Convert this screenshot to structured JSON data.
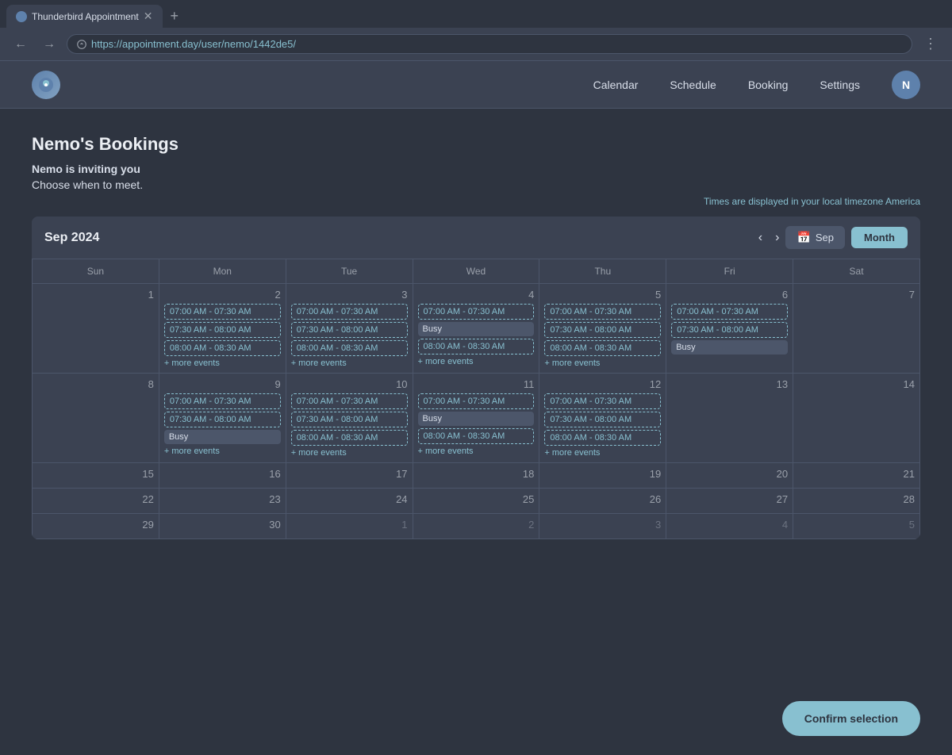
{
  "browser": {
    "tab_label": "Thunderbird Appointment",
    "url": "https://appointment.day/user/nemo/1442de5/",
    "new_tab_label": "+"
  },
  "nav": {
    "calendar": "Calendar",
    "schedule": "Schedule",
    "booking": "Booking",
    "settings": "Settings",
    "avatar_initial": "N"
  },
  "page": {
    "title": "Nemo's Bookings",
    "invite_text": "Nemo is inviting you",
    "choose_text": "Choose when to meet.",
    "timezone_text": "Times are displayed in your local timezone America"
  },
  "calendar": {
    "header_title": "Sep 2024",
    "sep_button": "Sep",
    "month_button": "Month",
    "prev_label": "‹",
    "next_label": "›",
    "days": [
      "Sun",
      "Mon",
      "Tue",
      "Wed",
      "Thu",
      "Fri",
      "Sat"
    ],
    "weeks": [
      [
        {
          "num": "1",
          "events": [],
          "other": false
        },
        {
          "num": "2",
          "events": [
            "07:00 AM - 07:30 AM",
            "07:30 AM - 08:00 AM",
            "08:00 AM - 08:30 AM"
          ],
          "more": "+ more events",
          "other": false
        },
        {
          "num": "3",
          "events": [
            "07:00 AM - 07:30 AM",
            "07:30 AM - 08:00 AM",
            "08:00 AM - 08:30 AM"
          ],
          "more": "+ more events",
          "other": false
        },
        {
          "num": "4",
          "events": [
            "07:00 AM - 07:30 AM",
            "busy",
            "08:00 AM - 08:30 AM"
          ],
          "more": "+ more events",
          "other": false
        },
        {
          "num": "5",
          "events": [
            "07:00 AM - 07:30 AM",
            "07:30 AM - 08:00 AM",
            "08:00 AM - 08:30 AM"
          ],
          "more": "+ more events",
          "other": false
        },
        {
          "num": "6",
          "events": [
            "07:00 AM - 07:30 AM",
            "07:30 AM - 08:00 AM",
            "busy"
          ],
          "more": "",
          "other": false
        },
        {
          "num": "7",
          "events": [],
          "other": false
        }
      ],
      [
        {
          "num": "8",
          "events": [],
          "other": false
        },
        {
          "num": "9",
          "events": [
            "07:00 AM - 07:30 AM",
            "07:30 AM - 08:00 AM",
            "busy"
          ],
          "more": "+ more events",
          "other": false
        },
        {
          "num": "10",
          "events": [
            "07:00 AM - 07:30 AM",
            "07:30 AM - 08:00 AM",
            "08:00 AM - 08:30 AM"
          ],
          "more": "+ more events",
          "other": false
        },
        {
          "num": "11",
          "events": [
            "07:00 AM - 07:30 AM",
            "busy",
            "08:00 AM - 08:30 AM"
          ],
          "more": "+ more events",
          "other": false
        },
        {
          "num": "12",
          "events": [
            "07:00 AM - 07:30 AM",
            "07:30 AM - 08:00 AM",
            "08:00 AM - 08:30 AM"
          ],
          "more": "+ more events",
          "other": false
        },
        {
          "num": "13",
          "events": [],
          "other": false
        },
        {
          "num": "14",
          "events": [],
          "other": false
        }
      ],
      [
        {
          "num": "15",
          "events": [],
          "other": false
        },
        {
          "num": "16",
          "events": [],
          "other": false
        },
        {
          "num": "17",
          "events": [],
          "other": false
        },
        {
          "num": "18",
          "events": [],
          "other": false
        },
        {
          "num": "19",
          "events": [],
          "other": false
        },
        {
          "num": "20",
          "events": [],
          "other": false
        },
        {
          "num": "21",
          "events": [],
          "other": false
        }
      ],
      [
        {
          "num": "22",
          "events": [],
          "other": false
        },
        {
          "num": "23",
          "events": [],
          "other": false
        },
        {
          "num": "24",
          "events": [],
          "other": false
        },
        {
          "num": "25",
          "events": [],
          "other": false
        },
        {
          "num": "26",
          "events": [],
          "other": false
        },
        {
          "num": "27",
          "events": [],
          "other": false
        },
        {
          "num": "28",
          "events": [],
          "other": false
        }
      ],
      [
        {
          "num": "29",
          "events": [],
          "other": false
        },
        {
          "num": "30",
          "events": [],
          "other": false
        },
        {
          "num": "1",
          "events": [],
          "other": true
        },
        {
          "num": "2",
          "events": [],
          "other": true
        },
        {
          "num": "3",
          "events": [],
          "other": true
        },
        {
          "num": "4",
          "events": [],
          "other": true
        },
        {
          "num": "5",
          "events": [],
          "other": true
        }
      ]
    ]
  },
  "confirm_button": "Confirm selection"
}
